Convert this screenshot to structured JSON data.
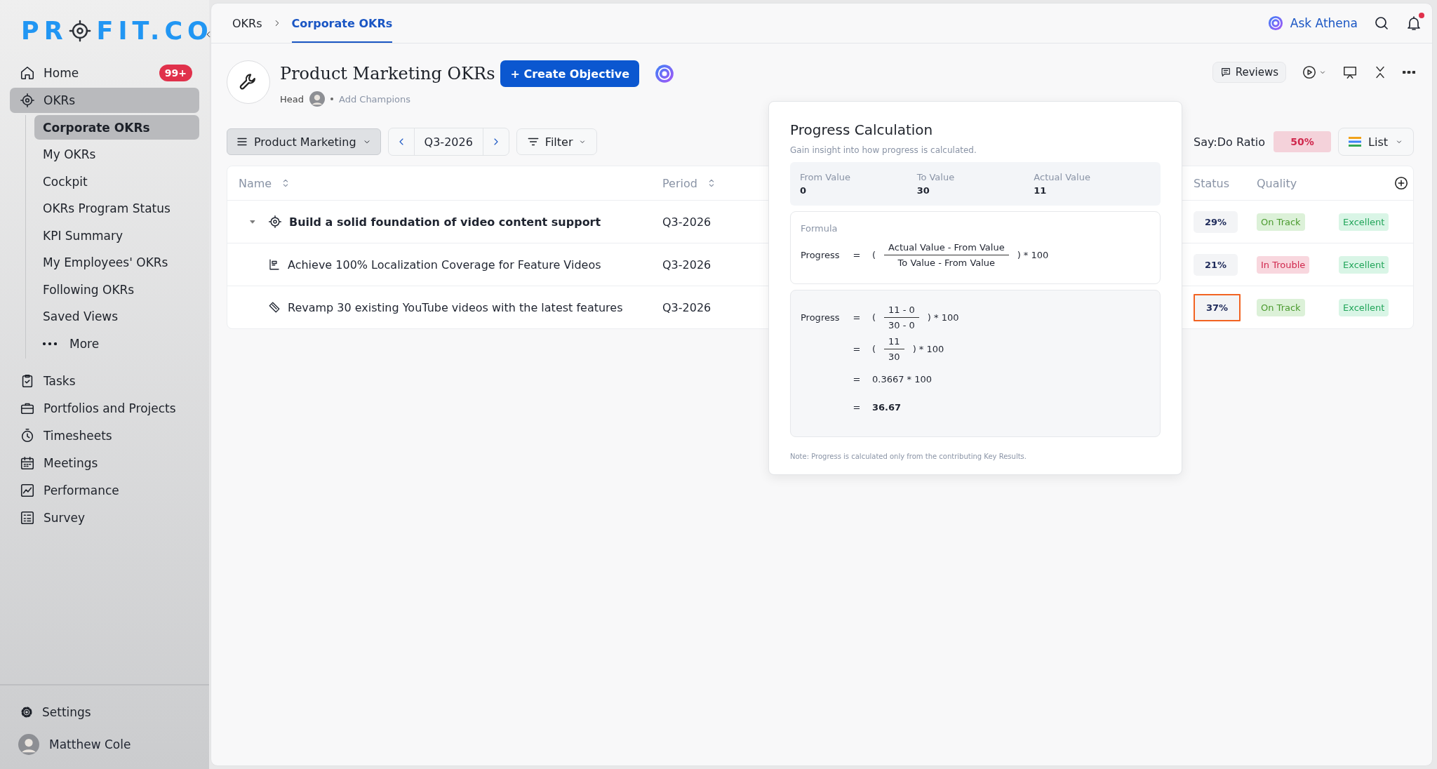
{
  "sidebar": {
    "logo": {
      "before": "PR",
      "after": "FIT.CO"
    },
    "items": [
      {
        "label": "Home",
        "badge": "99+",
        "selected": false
      },
      {
        "label": "OKRs",
        "selected": true,
        "children": [
          {
            "label": "Corporate OKRs",
            "kind": "link",
            "selected": true
          },
          {
            "label": "My OKRs",
            "kind": "link",
            "selected": false
          },
          {
            "label": "Cockpit",
            "kind": "link",
            "selected": false
          },
          {
            "label": "OKRs Program Status",
            "kind": "link",
            "selected": false
          },
          {
            "label": "KPI Summary",
            "kind": "link",
            "selected": false
          },
          {
            "label": "My Employees' OKRs",
            "kind": "link",
            "selected": false
          },
          {
            "label": "Following OKRs",
            "kind": "link",
            "selected": false
          },
          {
            "label": "Saved Views",
            "kind": "link",
            "selected": false
          },
          {
            "label": "More",
            "kind": "more",
            "selected": false
          }
        ]
      },
      {
        "label": "Tasks",
        "selected": false
      },
      {
        "label": "Portfolios and Projects",
        "selected": false
      },
      {
        "label": "Timesheets",
        "selected": false
      },
      {
        "label": "Meetings",
        "selected": false
      },
      {
        "label": "Performance",
        "selected": false
      },
      {
        "label": "Survey",
        "selected": false
      }
    ],
    "settings": "Settings",
    "user": "Matthew Cole"
  },
  "top_bar": {
    "breadcrumbs": [
      {
        "label": "OKRs",
        "selected": false
      },
      {
        "label": "Corporate OKRs",
        "selected": true
      }
    ],
    "assistant": "Ask Athena",
    "notifications": true
  },
  "header": {
    "title": "Product Marketing OKRs",
    "create_button": "+ Create Objective",
    "head_label": "Head",
    "add_champions": "Add Champions",
    "reviews": "Reviews"
  },
  "toolbar": {
    "group": "Product Marketing",
    "period": "Q3-2026",
    "filter": "Filter",
    "say_do_label": "Say:Do Ratio",
    "say_do_value": "50%",
    "view": "List"
  },
  "table": {
    "columns": [
      "Name",
      "Period",
      "Status",
      "Quality"
    ],
    "rows": [
      {
        "kind": "objective",
        "name": "Build a solid foundation of video content support",
        "period": "Q3-2026",
        "progress": "29%",
        "selected": false,
        "status": {
          "label": "On Track",
          "kind": "on_track"
        },
        "quality": "Excellent",
        "expanded": true,
        "children": [
          {
            "kind": "key_result",
            "name": "Achieve 100% Localization Coverage for Feature Videos",
            "period": "Q3-2026",
            "progress": "21%",
            "selected": false,
            "status": {
              "label": "In Trouble",
              "kind": "in_trouble"
            },
            "quality": "Excellent"
          },
          {
            "kind": "milestone",
            "name": "Revamp 30 existing YouTube videos with the latest features",
            "period": "Q3-2026",
            "progress": "37%",
            "selected": true,
            "status": {
              "label": "On Track",
              "kind": "on_track"
            },
            "quality": "Excellent"
          }
        ]
      }
    ]
  },
  "popup": {
    "title": "Progress Calculation",
    "subtitle": "Gain insight into how progress is calculated.",
    "values": [
      {
        "label": "From Value",
        "value": "0"
      },
      {
        "label": "To Value",
        "value": "30"
      },
      {
        "label": "Actual Value",
        "value": "11"
      }
    ],
    "formula_label": "Formula",
    "formula": {
      "kind": "fraction",
      "lhs": "Progress",
      "eq": "=",
      "open": "(",
      "numerator": "Actual Value - From Value",
      "denominator": "To Value - From Value",
      "close": ") * 100"
    },
    "steps": [
      {
        "kind": "fraction",
        "lhs": "Progress",
        "eq": "=",
        "open": "(",
        "numerator": "11 - 0",
        "denominator": "30 - 0",
        "close": ") * 100"
      },
      {
        "kind": "fraction",
        "eq": "=",
        "open": "(",
        "numerator": "11",
        "denominator": "30",
        "close": ") * 100"
      },
      {
        "kind": "value",
        "eq": "=",
        "value": "0.3667 * 100"
      },
      {
        "kind": "result",
        "eq": "=",
        "value": "36.67"
      }
    ],
    "note": "Note: Progress is calculated only from the contributing Key Results."
  }
}
